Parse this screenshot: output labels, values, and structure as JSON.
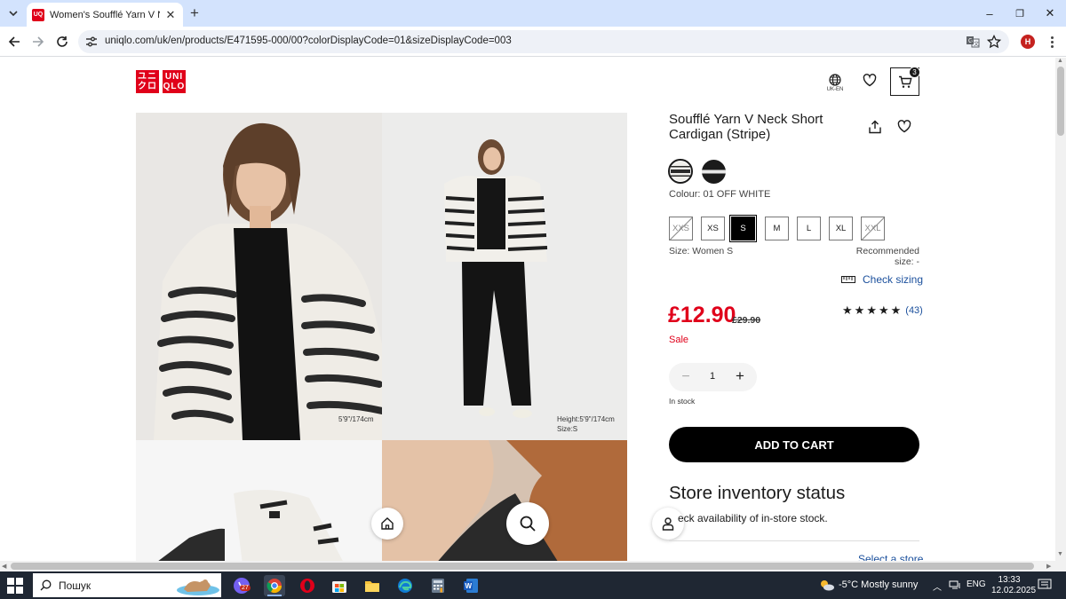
{
  "browser": {
    "tab_title": "Women's Soufflé Yarn V Neck S",
    "tab_favicon": "UNI QLO",
    "url": "uniqlo.com/uk/en/products/E471595-000/00?colorDisplayCode=01&sizeDisplayCode=003",
    "profile_initial": "H",
    "window_minimize": "–",
    "window_restore": "❐",
    "window_close": "✕",
    "tab_close": "✕",
    "new_tab": "+"
  },
  "header": {
    "logo_left": "ユニ\nクロ",
    "logo_right": "UNI\nQLO",
    "lang_label": "UK-EN",
    "cart_count": "3"
  },
  "gallery": {
    "photo1_note": "5'9\"/174cm",
    "photo2_note_height": "Height:5'9\"/174cm",
    "photo2_note_size": "Size:S"
  },
  "product": {
    "title": "Soufflé Yarn V Neck Short Cardigan (Stripe)",
    "colour_label": "Colour: 01 OFF WHITE",
    "colours": [
      {
        "name": "off-white",
        "hex": "#f0efeb",
        "selected": true
      },
      {
        "name": "black",
        "hex": "#1b1b1b",
        "selected": false
      }
    ],
    "sizes": [
      {
        "label": "XXS",
        "available": false,
        "selected": false
      },
      {
        "label": "XS",
        "available": true,
        "selected": false
      },
      {
        "label": "S",
        "available": true,
        "selected": true
      },
      {
        "label": "M",
        "available": true,
        "selected": false
      },
      {
        "label": "L",
        "available": true,
        "selected": false
      },
      {
        "label": "XL",
        "available": true,
        "selected": false
      },
      {
        "label": "XXL",
        "available": false,
        "selected": false
      }
    ],
    "size_label": "Size: Women S",
    "recommended_size": "Recommended size: -",
    "check_sizing": "Check sizing",
    "price": "£12.90",
    "old_price": "£29.90",
    "rating": 5,
    "review_count": "(43)",
    "sale_label": "Sale",
    "quantity": "1",
    "stock": "In stock",
    "add_to_cart": "ADD TO CART",
    "inventory_title": "Store inventory status",
    "inventory_sub": "eck availability of in-store stock.",
    "select_store": "Select a store",
    "brand_red": "#e0001a",
    "link_blue": "#1a4f9c"
  },
  "taskbar": {
    "search_placeholder": "Пошук",
    "viber_badge": "27",
    "weather": "-5°C  Mostly sunny",
    "lang": "ENG",
    "time": "13:33",
    "date": "12.02.2025",
    "notif_count": "1"
  }
}
